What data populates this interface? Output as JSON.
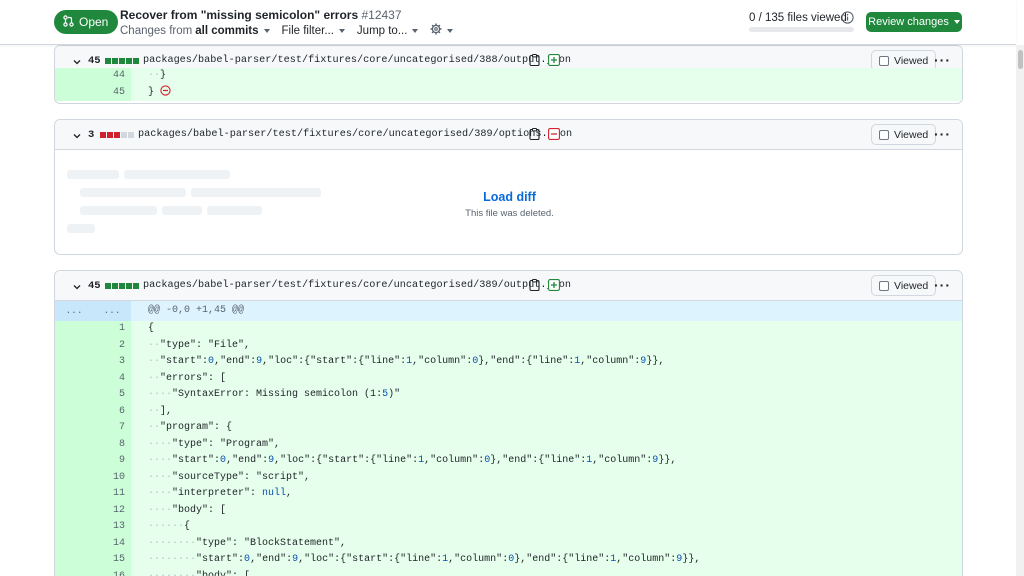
{
  "header": {
    "status": "Open",
    "title": "Recover from \"missing semicolon\" errors",
    "number": "#12437",
    "changes_from_prefix": "Changes from",
    "changes_from_value": "all commits",
    "file_filter": "File filter...",
    "jump_to": "Jump to...",
    "files_viewed": "0 / 135 files viewed",
    "files_viewed_fraction": 0,
    "review_button": "Review changes"
  },
  "colors": {
    "accent_green": "#1f883d",
    "addition_bg": "#e6ffec",
    "deletion_red": "#cf222e",
    "link_blue": "#0969da"
  },
  "files": [
    {
      "count": "45",
      "blocks": [
        "add",
        "add",
        "add",
        "add",
        "add"
      ],
      "path": "packages/babel-parser/test/fixtures/core/uncategorised/388/output.json",
      "status_icon": "diff-added-icon",
      "viewed_label": "Viewed",
      "lines": [
        {
          "num": "44",
          "code": "  }"
        },
        {
          "num": "45",
          "code": "}"
        }
      ]
    },
    {
      "count": "3",
      "blocks": [
        "del",
        "del",
        "del",
        "neutral",
        "neutral"
      ],
      "path": "packages/babel-parser/test/fixtures/core/uncategorised/389/options.json",
      "status_icon": "diff-removed-icon",
      "viewed_label": "Viewed",
      "load_diff": "Load diff",
      "load_diff_sub": "This file was deleted."
    },
    {
      "count": "45",
      "blocks": [
        "add",
        "add",
        "add",
        "add",
        "add"
      ],
      "path": "packages/babel-parser/test/fixtures/core/uncategorised/389/output.json",
      "status_icon": "diff-added-icon",
      "viewed_label": "Viewed",
      "hunk_expand_left": "...",
      "hunk_expand_right": "...",
      "hunk_header": "@@ -0,0 +1,45 @@",
      "lines": [
        {
          "num": "1",
          "code": "{"
        },
        {
          "num": "2",
          "code": "  \"type\": \"File\","
        },
        {
          "num": "3",
          "code": "  \"start\":0,\"end\":9,\"loc\":{\"start\":{\"line\":1,\"column\":0},\"end\":{\"line\":1,\"column\":9}},"
        },
        {
          "num": "4",
          "code": "  \"errors\": ["
        },
        {
          "num": "5",
          "code": "    \"SyntaxError: Missing semicolon (1:5)\""
        },
        {
          "num": "6",
          "code": "  ],"
        },
        {
          "num": "7",
          "code": "  \"program\": {"
        },
        {
          "num": "8",
          "code": "    \"type\": \"Program\","
        },
        {
          "num": "9",
          "code": "    \"start\":0,\"end\":9,\"loc\":{\"start\":{\"line\":1,\"column\":0},\"end\":{\"line\":1,\"column\":9}},"
        },
        {
          "num": "10",
          "code": "    \"sourceType\": \"script\","
        },
        {
          "num": "11",
          "code": "    \"interpreter\": null,"
        },
        {
          "num": "12",
          "code": "    \"body\": ["
        },
        {
          "num": "13",
          "code": "      {"
        },
        {
          "num": "14",
          "code": "        \"type\": \"BlockStatement\","
        },
        {
          "num": "15",
          "code": "        \"start\":0,\"end\":9,\"loc\":{\"start\":{\"line\":1,\"column\":0},\"end\":{\"line\":1,\"column\":9}},"
        },
        {
          "num": "16",
          "code": "        \"body\": ["
        }
      ]
    }
  ]
}
